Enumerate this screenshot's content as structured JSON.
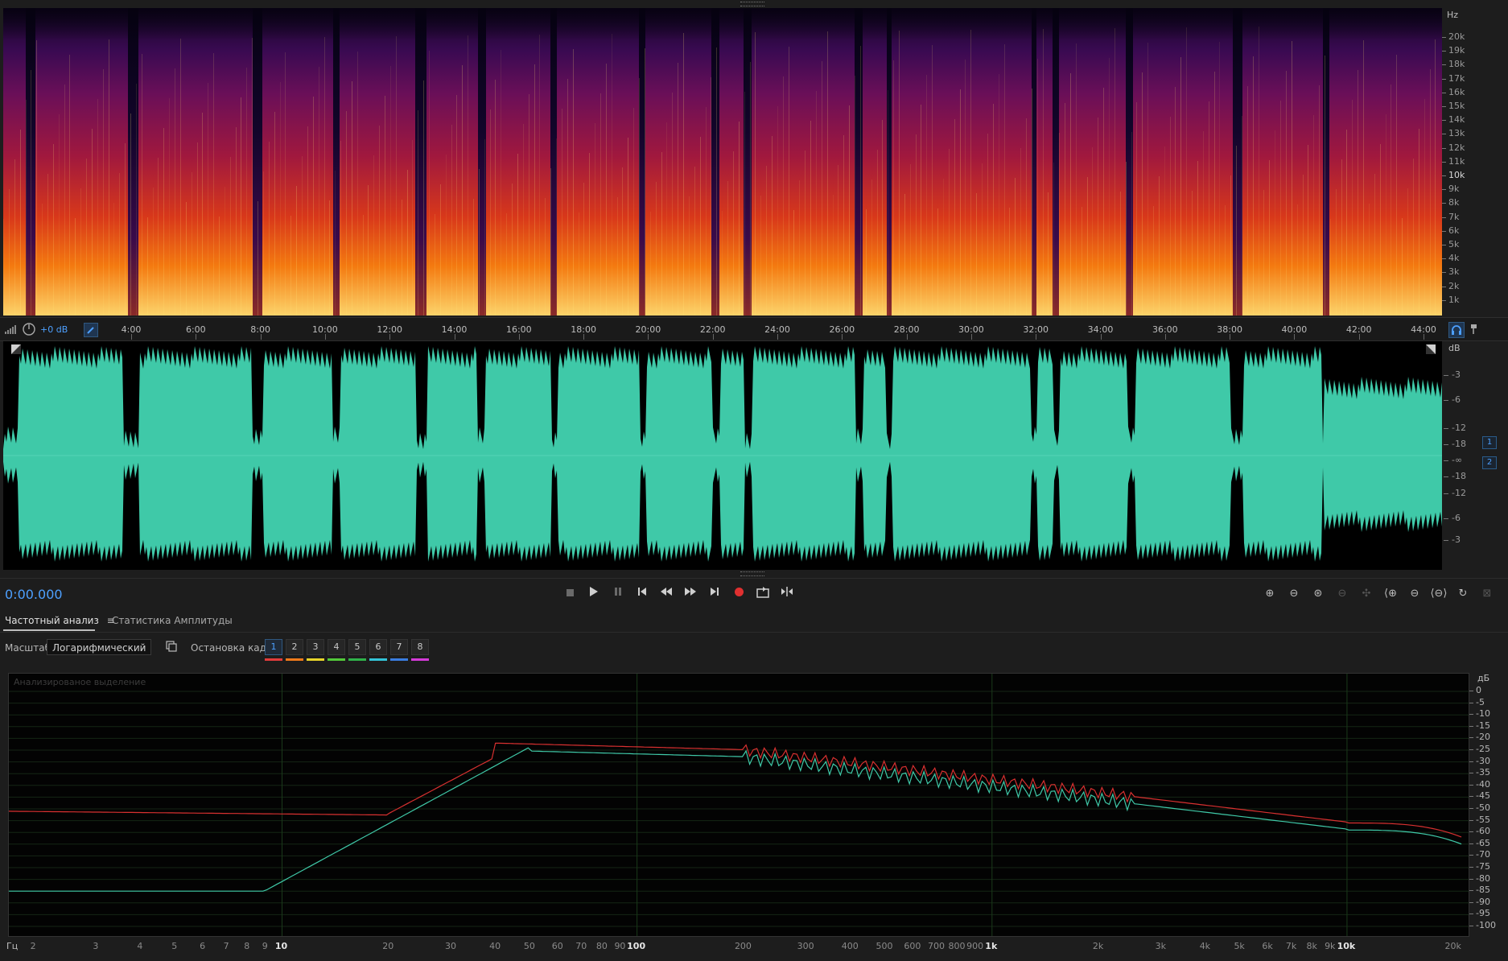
{
  "spectral": {
    "unit_label": "Hz",
    "freq_ticks": [
      "20k",
      "19k",
      "18k",
      "17k",
      "16k",
      "15k",
      "14k",
      "13k",
      "12k",
      "11k",
      "10k",
      "9k",
      "8k",
      "7k",
      "6k",
      "5k",
      "4k",
      "3k",
      "2k",
      "1k"
    ]
  },
  "timeline": {
    "level_label": "+0 dB",
    "ticks": [
      "4:00",
      "6:00",
      "8:00",
      "10:00",
      "12:00",
      "14:00",
      "16:00",
      "18:00",
      "20:00",
      "22:00",
      "24:00",
      "26:00",
      "28:00",
      "30:00",
      "32:00",
      "34:00",
      "36:00",
      "38:00",
      "40:00",
      "42:00",
      "44:00"
    ]
  },
  "waveform": {
    "unit_label": "dB",
    "db_ticks": [
      "-3",
      "-6",
      "-12",
      "-18",
      "-∞",
      "-18",
      "-12",
      "-6",
      "-3"
    ],
    "channels": [
      "1",
      "2"
    ],
    "color": "#3fc9a8"
  },
  "transport": {
    "time": "0:00.000",
    "record_color": "#e03030"
  },
  "panel": {
    "tabs": [
      "Частотный анализ",
      "Статистика Амплитуды"
    ],
    "scale_label": "Масштаб:",
    "scale_value": "Логарифмический",
    "freeze_label": "Остановка кадра:",
    "frames": [
      {
        "n": "1",
        "color": "#e23c3c"
      },
      {
        "n": "2",
        "color": "#f07a1a"
      },
      {
        "n": "3",
        "color": "#e8d52a"
      },
      {
        "n": "4",
        "color": "#52c93a"
      },
      {
        "n": "5",
        "color": "#2fb34a"
      },
      {
        "n": "6",
        "color": "#33c4d8"
      },
      {
        "n": "7",
        "color": "#3a7de0"
      },
      {
        "n": "8",
        "color": "#d43ad8"
      }
    ]
  },
  "analysis": {
    "watermark": "Анализированое выделение",
    "unit_label": "дБ",
    "hz_label": "Гц",
    "db_ticks": [
      "0",
      "-5",
      "-10",
      "-15",
      "-20",
      "-25",
      "-30",
      "-35",
      "-40",
      "-45",
      "-50",
      "-55",
      "-60",
      "-65",
      "-70",
      "-75",
      "-80",
      "-85",
      "-90",
      "-95",
      "-100"
    ],
    "hz_ticks": [
      "2",
      "3",
      "4",
      "5",
      "6",
      "7",
      "8",
      "9",
      "10",
      "20",
      "30",
      "40",
      "50",
      "60",
      "70",
      "80",
      "90",
      "100",
      "200",
      "300",
      "400",
      "500",
      "600",
      "700",
      "800",
      "900",
      "1k",
      "2k",
      "3k",
      "4k",
      "5k",
      "6k",
      "7k",
      "8k",
      "9k",
      "10k",
      "20k"
    ],
    "series_colors": {
      "left": "#d83030",
      "right": "#3fc9a8"
    }
  }
}
